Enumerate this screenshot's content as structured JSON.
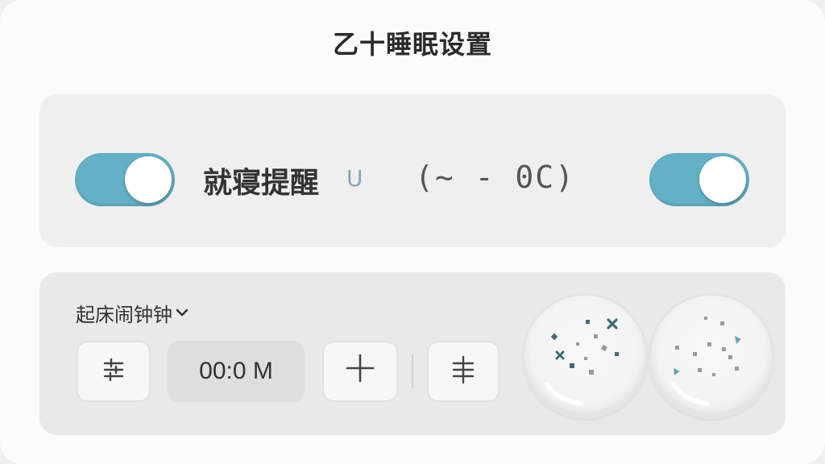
{
  "header": {
    "title": "乙十睡眠设置"
  },
  "bedtime": {
    "label": "就寝提醒",
    "suffix": "U",
    "time_range": "(~ - 0C)",
    "toggle_left_on": true,
    "toggle_right_on": true
  },
  "alarm": {
    "select_label": "起床闹钟钟",
    "time_display": "00:0 M",
    "plus_symbol": "+"
  },
  "colors": {
    "accent": "#63b0c7",
    "speck_dark": "#3f6b73",
    "speck_gray": "#9a9a9a",
    "speck_teal": "#5aa8bd"
  },
  "icons": {
    "adjust": "sliders-icon",
    "levels": "levels-icon",
    "chevron": "chevron-down-icon"
  }
}
